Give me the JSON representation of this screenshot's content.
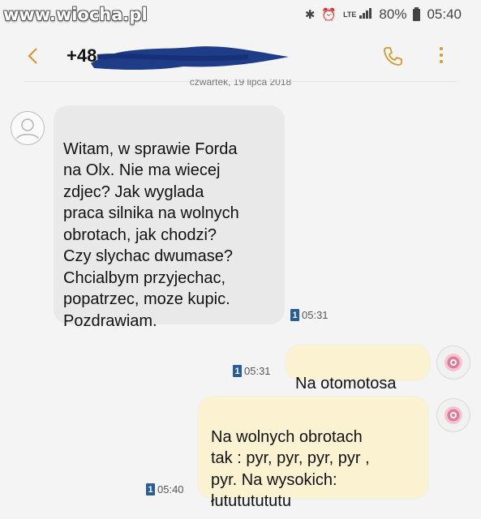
{
  "watermark": "www.wiocha.pl",
  "status_bar": {
    "network": "LTE",
    "battery": "80%",
    "time": "05:40"
  },
  "header": {
    "contact": "+48",
    "back_icon": "chevron-left-icon",
    "call_icon": "phone-icon",
    "menu_icon": "more-vert-icon"
  },
  "date_separator": "czwartek, 19 lipca 2018",
  "messages": [
    {
      "direction": "incoming",
      "text": "Witam, w sprawie Forda\nna Olx. Nie ma wiecej\nzdjec? Jak wyglada\npraca silnika na wolnych\nobrotach, jak chodzi?\nCzy slychac dwumase?\nChcialbym przyjechac,\npopatrzec, moze kupic.\nPozdrawiam.",
      "sim": "1",
      "time": "05:31"
    },
    {
      "direction": "outgoing",
      "text": "Na otomotosa",
      "sim": "1",
      "time": "05:31"
    },
    {
      "direction": "outgoing",
      "text": "Na wolnych obrotach\ntak : pyr,  pyr, pyr, pyr ,\npyr. Na wysokich:\nłutututututu",
      "sim": "1",
      "time": "05:40"
    }
  ],
  "colors": {
    "incoming_bubble": "#e9e9e9",
    "outgoing_bubble": "#fbf2d2",
    "accent": "#d29a2e",
    "sim_badge": "#2a5d95"
  }
}
